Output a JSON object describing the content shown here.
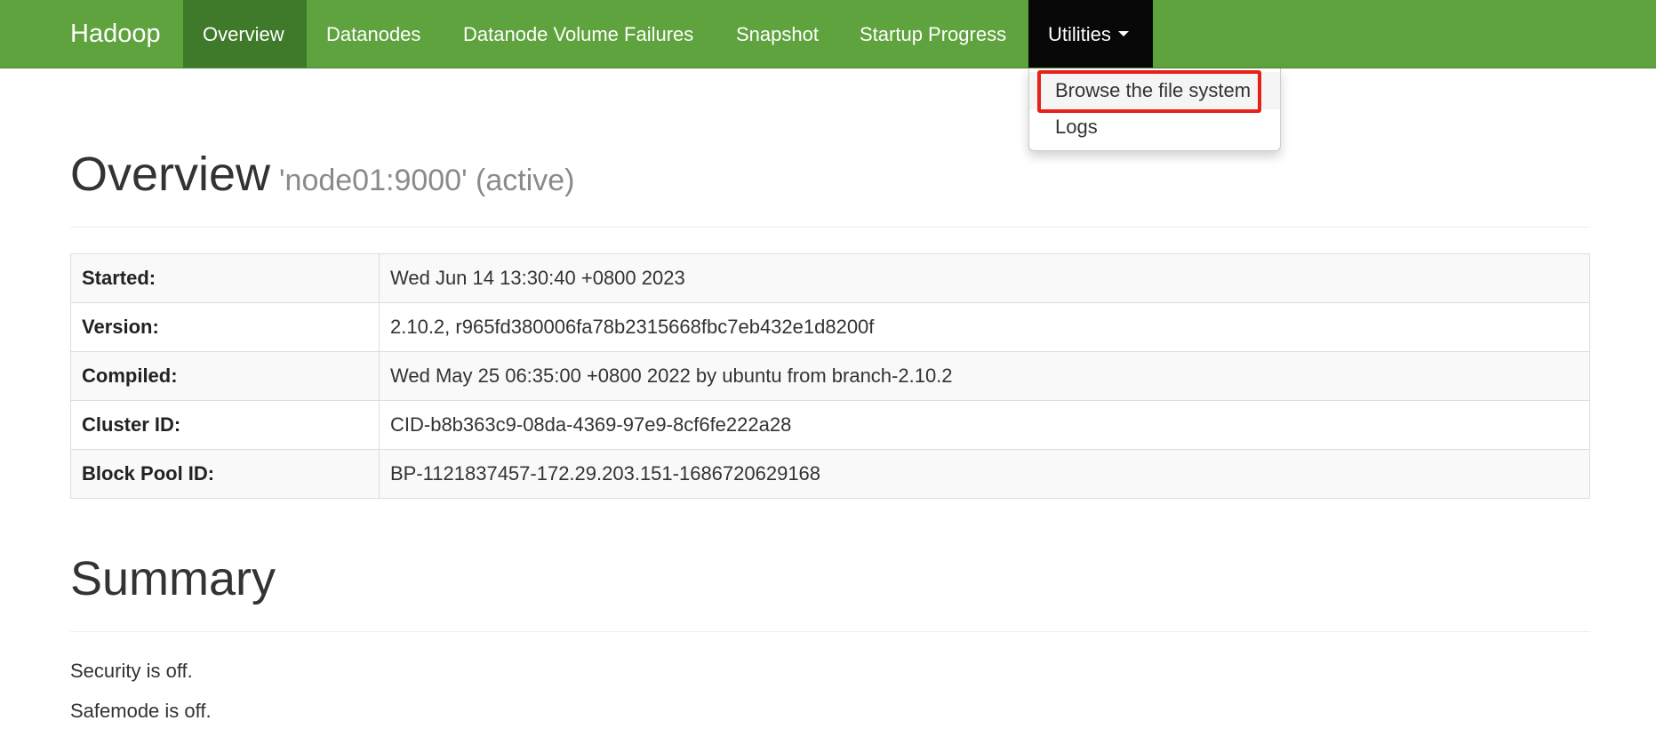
{
  "navbar": {
    "brand": "Hadoop",
    "items": [
      {
        "label": "Overview"
      },
      {
        "label": "Datanodes"
      },
      {
        "label": "Datanode Volume Failures"
      },
      {
        "label": "Snapshot"
      },
      {
        "label": "Startup Progress"
      },
      {
        "label": "Utilities"
      }
    ],
    "active_item": "Overview",
    "open_menu": "Utilities"
  },
  "utilities_menu": {
    "items": [
      {
        "label": "Browse the file system",
        "highlighted": true
      },
      {
        "label": "Logs",
        "highlighted": false
      }
    ]
  },
  "overview": {
    "title": "Overview",
    "subtitle": "'node01:9000' (active)",
    "rows": [
      {
        "key": "Started:",
        "value": "Wed Jun 14 13:30:40 +0800 2023"
      },
      {
        "key": "Version:",
        "value": "2.10.2, r965fd380006fa78b2315668fbc7eb432e1d8200f"
      },
      {
        "key": "Compiled:",
        "value": "Wed May 25 06:35:00 +0800 2022 by ubuntu from branch-2.10.2"
      },
      {
        "key": "Cluster ID:",
        "value": "CID-b8b363c9-08da-4369-97e9-8cf6fe222a28"
      },
      {
        "key": "Block Pool ID:",
        "value": "BP-1121837457-172.29.203.151-1686720629168"
      }
    ]
  },
  "summary": {
    "title": "Summary",
    "lines": [
      "Security is off.",
      "Safemode is off."
    ]
  },
  "colors": {
    "navbar_bg": "#5fa33e",
    "navbar_active_bg": "#3f7a2a",
    "navbar_open_bg": "#080808",
    "highlight_border": "#e8201a"
  }
}
